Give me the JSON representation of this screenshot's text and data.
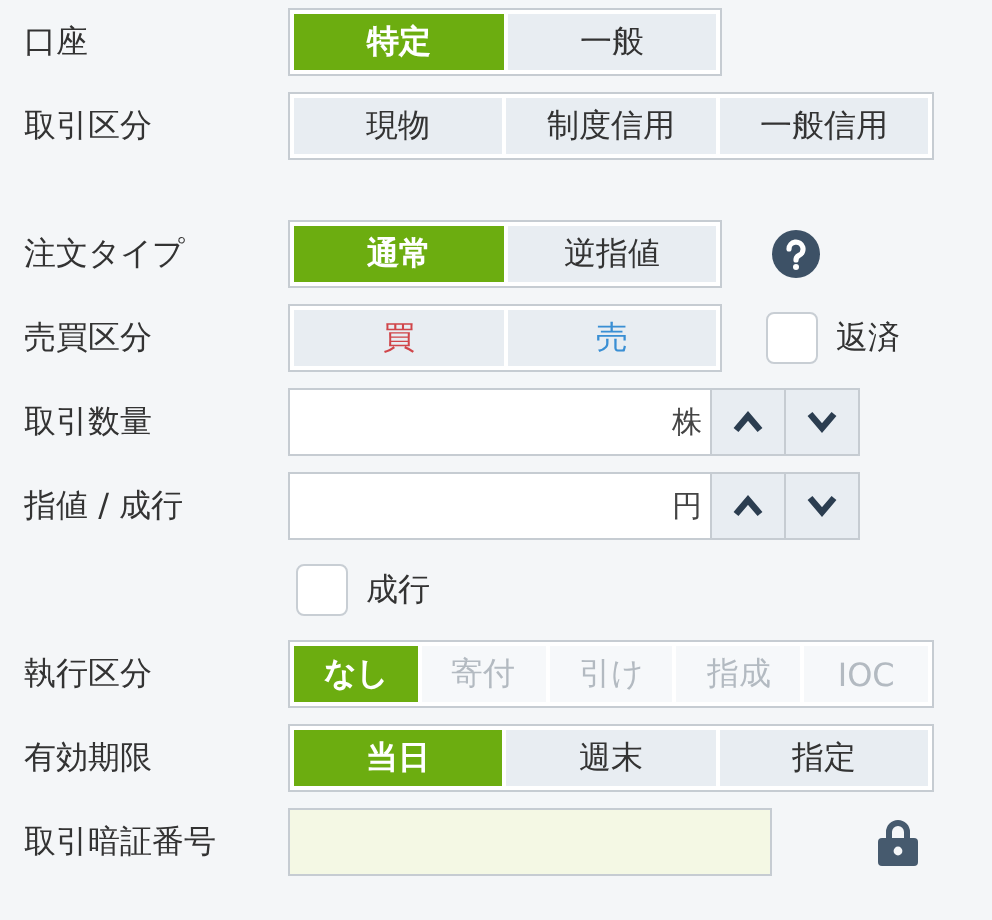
{
  "sections": [
    [
      {
        "kind": "segmented",
        "label": "口座",
        "options": [
          {
            "text": "特定",
            "selected": true,
            "disabled": false
          },
          {
            "text": "一般",
            "selected": false,
            "disabled": false
          }
        ]
      },
      {
        "kind": "segmented",
        "label": "取引区分",
        "options": [
          {
            "text": "現物",
            "selected": false,
            "disabled": false
          },
          {
            "text": "制度信用",
            "selected": false,
            "disabled": false
          },
          {
            "text": "一般信用",
            "selected": false,
            "disabled": false
          }
        ]
      }
    ],
    [
      {
        "kind": "segmented",
        "label": "注文タイプ",
        "help": true,
        "options": [
          {
            "text": "通常",
            "selected": true,
            "disabled": false
          },
          {
            "text": "逆指値",
            "selected": false,
            "disabled": false
          }
        ]
      },
      {
        "kind": "segmented",
        "label": "売買区分",
        "checkbox": {
          "label": "返済",
          "checked": false
        },
        "options": [
          {
            "text": "買",
            "selected": false,
            "disabled": false,
            "color": "#d0454a"
          },
          {
            "text": "売",
            "selected": false,
            "disabled": false,
            "color": "#3a8fd4"
          }
        ]
      },
      {
        "kind": "input",
        "label": "取引数量",
        "unit": "株",
        "stepper": true
      },
      {
        "kind": "input",
        "label": "指値 / 成行",
        "unit": "円",
        "stepper": true
      },
      {
        "kind": "checkbox",
        "label": "成行",
        "checked": false
      },
      {
        "kind": "segmented",
        "label": "執行区分",
        "options": [
          {
            "text": "なし",
            "selected": true,
            "disabled": false
          },
          {
            "text": "寄付",
            "selected": false,
            "disabled": true
          },
          {
            "text": "引け",
            "selected": false,
            "disabled": true
          },
          {
            "text": "指成",
            "selected": false,
            "disabled": true
          },
          {
            "text": "IOC",
            "selected": false,
            "disabled": true
          }
        ]
      },
      {
        "kind": "segmented",
        "label": "有効期限",
        "options": [
          {
            "text": "当日",
            "selected": true,
            "disabled": false
          },
          {
            "text": "週末",
            "selected": false,
            "disabled": false
          },
          {
            "text": "指定",
            "selected": false,
            "disabled": false
          }
        ]
      },
      {
        "kind": "input",
        "label": "取引暗証番号",
        "secret": true,
        "locked": true,
        "stepper": false
      }
    ]
  ]
}
